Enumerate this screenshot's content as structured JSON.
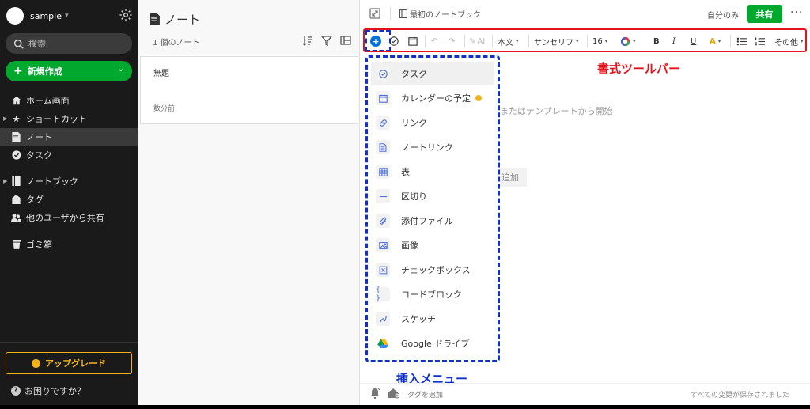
{
  "sidebar": {
    "account_name": "sample",
    "search_placeholder": "検索",
    "new_button": "新規作成",
    "items": [
      {
        "label": "ホーム画面"
      },
      {
        "label": "ショートカット"
      },
      {
        "label": "ノート"
      },
      {
        "label": "タスク"
      },
      {
        "label": "ノートブック"
      },
      {
        "label": "タグ"
      },
      {
        "label": "他のユーザから共有"
      },
      {
        "label": "ゴミ箱"
      }
    ],
    "upgrade": "アップグレード",
    "help": "お困りですか？"
  },
  "notelist": {
    "title": "ノート",
    "count": "1 個のノート",
    "notes": [
      {
        "title": "無題",
        "date": "数分前"
      }
    ]
  },
  "editor": {
    "notebook": "最初のノートブック",
    "visibility": "自分のみ",
    "share": "共有",
    "more": "···",
    "toolbar": {
      "ai": "AI",
      "style": "本文",
      "font": "サンセリフ",
      "size": "16",
      "bold": "B",
      "italic": "I",
      "underline": "U",
      "other": "その他"
    },
    "hint": "またはテンプレートから開始",
    "add": "追加",
    "tag_add": "タグを追加",
    "saved": "すべての変更が保存されました"
  },
  "insert_menu": {
    "items": [
      {
        "label": "タスク",
        "icon": "task-icon"
      },
      {
        "label": "カレンダーの予定",
        "icon": "calendar-icon"
      },
      {
        "label": "リンク",
        "icon": "link-icon"
      },
      {
        "label": "ノートリンク",
        "icon": "note-link-icon"
      },
      {
        "label": "表",
        "icon": "table-icon"
      },
      {
        "label": "区切り",
        "icon": "divider-icon"
      },
      {
        "label": "添付ファイル",
        "icon": "attachment-icon"
      },
      {
        "label": "画像",
        "icon": "image-icon"
      },
      {
        "label": "チェックボックス",
        "icon": "checkbox-icon"
      },
      {
        "label": "コードブロック",
        "icon": "code-block-icon"
      },
      {
        "label": "スケッチ",
        "icon": "sketch-icon"
      },
      {
        "label": "Google ドライブ",
        "icon": "google-drive-icon"
      }
    ]
  },
  "annotations": {
    "toolbar": "書式ツールバー",
    "insert_menu": "挿入メニュー"
  },
  "colors": {
    "accent_green": "#00a82d",
    "annotation_red": "#e5131b",
    "annotation_blue": "#1030c8",
    "upgrade_gold": "#f3b21a"
  }
}
